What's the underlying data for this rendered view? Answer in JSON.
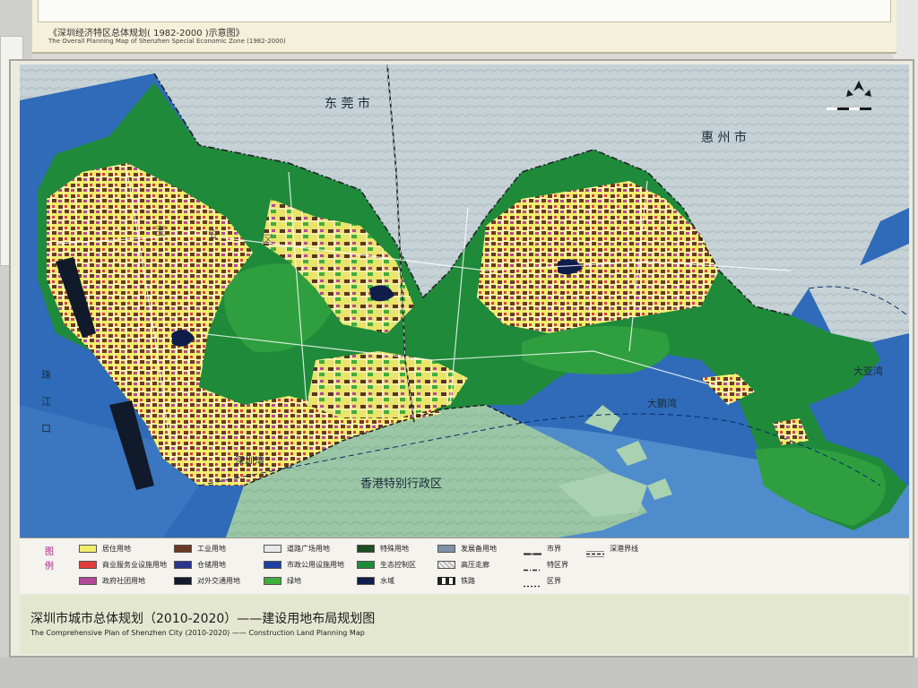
{
  "top_panel": {
    "title_cn": "《深圳经济特区总体规划( 1982-2000 )示意图》",
    "title_en": "The Overall Planning Map of Shenzhen Special Economic Zone (1982-2000)"
  },
  "map": {
    "labels": {
      "dongguan": "东  莞  市",
      "huizhou": "惠  州  市",
      "hongkong": "香港特别行政区",
      "dapeng_bay": "大鹏湾",
      "shenzhen_bay": "深圳湾",
      "daya_bay": "大亚湾",
      "zhujiang_kou": [
        "珠",
        "江",
        "口"
      ],
      "baoan": [
        "宝",
        "安",
        "区"
      ]
    },
    "colors": {
      "sea": "#2f6bb8",
      "sea_light": "#6fa3d6",
      "hk_land": "#9fc9a8",
      "ecological": "#1f8a3a",
      "green": "#2f9e3f",
      "residential": "#f0ef6a",
      "industrial": "#6b3a22",
      "commercial": "#e23b3b",
      "government": "#b3479a",
      "storage": "#2a3590",
      "transport": "#101a2a",
      "neighbor_land": "#c9d3d6"
    }
  },
  "legend": {
    "heading": [
      "图",
      "例"
    ],
    "items": [
      {
        "label": "居住用地",
        "color": "#f0ef6a",
        "kind": "fill"
      },
      {
        "label": "商业服务业设施用地",
        "color": "#e23b3b",
        "kind": "fill"
      },
      {
        "label": "政府社团用地",
        "color": "#b3479a",
        "kind": "fill"
      },
      {
        "label": "工业用地",
        "color": "#6b3a22",
        "kind": "fill"
      },
      {
        "label": "仓储用地",
        "color": "#2a3590",
        "kind": "fill"
      },
      {
        "label": "对外交通用地",
        "color": "#101a2a",
        "kind": "fill"
      },
      {
        "label": "道路广场用地",
        "color": "#e8e8e8",
        "kind": "fill"
      },
      {
        "label": "市政公用设施用地",
        "color": "#1e3fa0",
        "kind": "fill"
      },
      {
        "label": "绿地",
        "color": "#3fae3a",
        "kind": "fill"
      },
      {
        "label": "特殊用地",
        "color": "#1f4d24",
        "kind": "fill"
      },
      {
        "label": "生态控制区",
        "color": "#1f8a3a",
        "kind": "fill"
      },
      {
        "label": "水域",
        "color": "#0e1d4a",
        "kind": "fill"
      },
      {
        "label": "发展备用地",
        "color": "#7f93a6",
        "kind": "fill"
      },
      {
        "label": "高压走廊",
        "color": "#cfcfcf",
        "kind": "hatch"
      },
      {
        "label": "铁路",
        "color": "#222222",
        "kind": "rail"
      },
      {
        "label": "市界",
        "color": "#222222",
        "kind": "boundary"
      },
      {
        "label": "特区界",
        "color": "#222222",
        "kind": "boundary"
      },
      {
        "label": "区界",
        "color": "#222222",
        "kind": "boundary"
      },
      {
        "label": "深港界线",
        "color": "#222222",
        "kind": "boundary"
      }
    ]
  },
  "caption": {
    "title_cn": "深圳市城市总体规划（2010-2020）——建设用地布局规划图",
    "title_en": "The Comprehensive Plan of Shenzhen City  (2010-2020) —— Construction Land Planning Map"
  }
}
